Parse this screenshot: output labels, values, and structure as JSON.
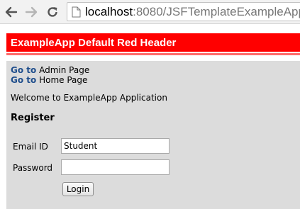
{
  "browser": {
    "url_host": "localhost",
    "url_rest": ":8080/JSFTemplateExampleApp/",
    "icons": [
      "back-arrow-icon",
      "forward-arrow-icon",
      "reload-icon",
      "page-icon"
    ]
  },
  "header": {
    "title": "ExampleApp Default Red Header",
    "background_color": "#ff0000"
  },
  "nav_links": {
    "goto_label": "Go to",
    "admin_target": "Admin Page",
    "home_target": "Home Page"
  },
  "welcome_text": "Welcome to ExampleApp Application",
  "register": {
    "title": "Register",
    "email_label": "Email ID",
    "email_value": "Student",
    "password_label": "Password",
    "password_value": "",
    "login_label": "Login"
  }
}
